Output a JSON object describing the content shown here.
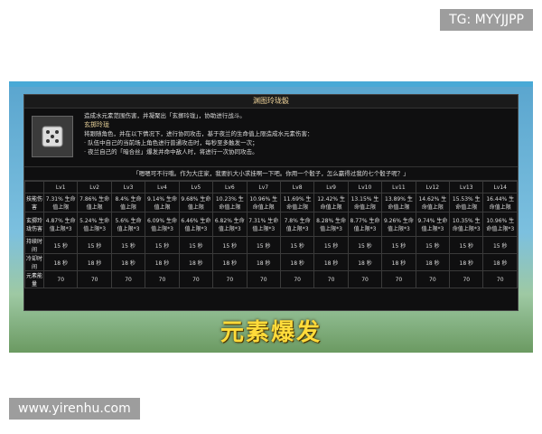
{
  "watermark_top": "TG: MYYJJPP",
  "watermark_bottom": "www.yirenhu.com",
  "panel": {
    "title": "渊图玲珑骰",
    "skill_desc": "造成水元素范围伤害，并凝聚出「玄掷玲珑」，协助进行战斗。",
    "skill_name": "玄掷玲珑",
    "line1": "将跟随角色，并在以下情况下，进行协同攻击，基于夜兰的生命值上限造成水元素伤害：",
    "line2": "· 队伍中自己的当前场上角色进行普通攻击时，每秒至多触发一次；",
    "line3": "· 夜兰自己的「暗合丝」爆发并命中敌人时，将进行一次协同攻击。",
    "quote": "「嗯嗯可不行哦。作为大庄家，我要扒大小求挂啊一下吧。你用一个骰子，怎么赢得过我的七个骰子呢？」"
  },
  "table": {
    "levels": [
      "Lv1",
      "Lv2",
      "Lv3",
      "Lv4",
      "Lv5",
      "Lv6",
      "Lv7",
      "Lv8",
      "Lv9",
      "Lv10",
      "Lv11",
      "Lv12",
      "Lv13",
      "Lv14"
    ],
    "rows": [
      {
        "label": "技能伤害",
        "cells": [
          "7.31% 生命值上限",
          "7.86% 生命值上限",
          "8.4% 生命值上限",
          "9.14% 生命值上限",
          "9.68% 生命值上限",
          "10.23% 生命值上限",
          "10.96% 生命值上限",
          "11.69% 生命值上限",
          "12.42% 生命值上限",
          "13.15% 生命值上限",
          "13.89% 生命值上限",
          "14.62% 生命值上限",
          "15.53% 生命值上限",
          "16.44% 生命值上限"
        ]
      },
      {
        "label": "玄掷玲珑伤害",
        "cells": [
          "4.87% 生命值上限*3",
          "5.24% 生命值上限*3",
          "5.6% 生命值上限*3",
          "6.09% 生命值上限*3",
          "6.46% 生命值上限*3",
          "6.82% 生命值上限*3",
          "7.31% 生命值上限*3",
          "7.8% 生命值上限*3",
          "8.28% 生命值上限*3",
          "8.77% 生命值上限*3",
          "9.26% 生命值上限*3",
          "9.74% 生命值上限*3",
          "10.35% 生命值上限*3",
          "10.96% 生命值上限*3"
        ]
      },
      {
        "label": "持续时间",
        "cells": [
          "15 秒",
          "15 秒",
          "15 秒",
          "15 秒",
          "15 秒",
          "15 秒",
          "15 秒",
          "15 秒",
          "15 秒",
          "15 秒",
          "15 秒",
          "15 秒",
          "15 秒",
          "15 秒"
        ]
      },
      {
        "label": "冷却时间",
        "cells": [
          "18 秒",
          "18 秒",
          "18 秒",
          "18 秒",
          "18 秒",
          "18 秒",
          "18 秒",
          "18 秒",
          "18 秒",
          "18 秒",
          "18 秒",
          "18 秒",
          "18 秒",
          "18 秒"
        ]
      },
      {
        "label": "元素能量",
        "cells": [
          "70",
          "70",
          "70",
          "70",
          "70",
          "70",
          "70",
          "70",
          "70",
          "70",
          "70",
          "70",
          "70",
          "70"
        ]
      }
    ]
  },
  "banner": "元素爆发"
}
